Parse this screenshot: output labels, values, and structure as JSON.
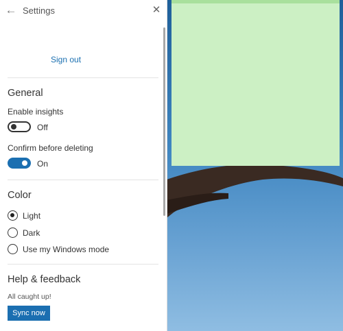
{
  "header": {
    "title": "Settings"
  },
  "account": {
    "sign_out_label": "Sign out"
  },
  "general": {
    "title": "General",
    "insights": {
      "label": "Enable insights",
      "state": "Off"
    },
    "confirm_delete": {
      "label": "Confirm before deleting",
      "state": "On"
    }
  },
  "color": {
    "title": "Color",
    "options": [
      {
        "label": "Light",
        "selected": true
      },
      {
        "label": "Dark",
        "selected": false
      },
      {
        "label": "Use my Windows mode",
        "selected": false
      }
    ]
  },
  "help": {
    "title": "Help & feedback",
    "status": "All caught up!",
    "sync_label": "Sync now"
  },
  "colors": {
    "accent": "#1b6fb1",
    "note": "#ccf0c4",
    "note_top": "#a9e09d",
    "link": "#1a6fb0"
  }
}
